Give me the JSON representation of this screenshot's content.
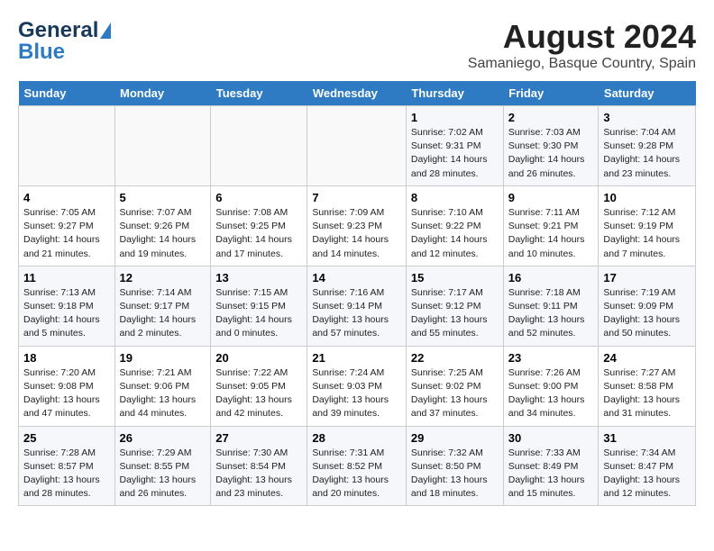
{
  "header": {
    "logo_line1": "General",
    "logo_line2": "Blue",
    "title": "August 2024",
    "subtitle": "Samaniego, Basque Country, Spain"
  },
  "days_of_week": [
    "Sunday",
    "Monday",
    "Tuesday",
    "Wednesday",
    "Thursday",
    "Friday",
    "Saturday"
  ],
  "weeks": [
    [
      {
        "day": "",
        "info": ""
      },
      {
        "day": "",
        "info": ""
      },
      {
        "day": "",
        "info": ""
      },
      {
        "day": "",
        "info": ""
      },
      {
        "day": "1",
        "info": "Sunrise: 7:02 AM\nSunset: 9:31 PM\nDaylight: 14 hours and 28 minutes."
      },
      {
        "day": "2",
        "info": "Sunrise: 7:03 AM\nSunset: 9:30 PM\nDaylight: 14 hours and 26 minutes."
      },
      {
        "day": "3",
        "info": "Sunrise: 7:04 AM\nSunset: 9:28 PM\nDaylight: 14 hours and 23 minutes."
      }
    ],
    [
      {
        "day": "4",
        "info": "Sunrise: 7:05 AM\nSunset: 9:27 PM\nDaylight: 14 hours and 21 minutes."
      },
      {
        "day": "5",
        "info": "Sunrise: 7:07 AM\nSunset: 9:26 PM\nDaylight: 14 hours and 19 minutes."
      },
      {
        "day": "6",
        "info": "Sunrise: 7:08 AM\nSunset: 9:25 PM\nDaylight: 14 hours and 17 minutes."
      },
      {
        "day": "7",
        "info": "Sunrise: 7:09 AM\nSunset: 9:23 PM\nDaylight: 14 hours and 14 minutes."
      },
      {
        "day": "8",
        "info": "Sunrise: 7:10 AM\nSunset: 9:22 PM\nDaylight: 14 hours and 12 minutes."
      },
      {
        "day": "9",
        "info": "Sunrise: 7:11 AM\nSunset: 9:21 PM\nDaylight: 14 hours and 10 minutes."
      },
      {
        "day": "10",
        "info": "Sunrise: 7:12 AM\nSunset: 9:19 PM\nDaylight: 14 hours and 7 minutes."
      }
    ],
    [
      {
        "day": "11",
        "info": "Sunrise: 7:13 AM\nSunset: 9:18 PM\nDaylight: 14 hours and 5 minutes."
      },
      {
        "day": "12",
        "info": "Sunrise: 7:14 AM\nSunset: 9:17 PM\nDaylight: 14 hours and 2 minutes."
      },
      {
        "day": "13",
        "info": "Sunrise: 7:15 AM\nSunset: 9:15 PM\nDaylight: 14 hours and 0 minutes."
      },
      {
        "day": "14",
        "info": "Sunrise: 7:16 AM\nSunset: 9:14 PM\nDaylight: 13 hours and 57 minutes."
      },
      {
        "day": "15",
        "info": "Sunrise: 7:17 AM\nSunset: 9:12 PM\nDaylight: 13 hours and 55 minutes."
      },
      {
        "day": "16",
        "info": "Sunrise: 7:18 AM\nSunset: 9:11 PM\nDaylight: 13 hours and 52 minutes."
      },
      {
        "day": "17",
        "info": "Sunrise: 7:19 AM\nSunset: 9:09 PM\nDaylight: 13 hours and 50 minutes."
      }
    ],
    [
      {
        "day": "18",
        "info": "Sunrise: 7:20 AM\nSunset: 9:08 PM\nDaylight: 13 hours and 47 minutes."
      },
      {
        "day": "19",
        "info": "Sunrise: 7:21 AM\nSunset: 9:06 PM\nDaylight: 13 hours and 44 minutes."
      },
      {
        "day": "20",
        "info": "Sunrise: 7:22 AM\nSunset: 9:05 PM\nDaylight: 13 hours and 42 minutes."
      },
      {
        "day": "21",
        "info": "Sunrise: 7:24 AM\nSunset: 9:03 PM\nDaylight: 13 hours and 39 minutes."
      },
      {
        "day": "22",
        "info": "Sunrise: 7:25 AM\nSunset: 9:02 PM\nDaylight: 13 hours and 37 minutes."
      },
      {
        "day": "23",
        "info": "Sunrise: 7:26 AM\nSunset: 9:00 PM\nDaylight: 13 hours and 34 minutes."
      },
      {
        "day": "24",
        "info": "Sunrise: 7:27 AM\nSunset: 8:58 PM\nDaylight: 13 hours and 31 minutes."
      }
    ],
    [
      {
        "day": "25",
        "info": "Sunrise: 7:28 AM\nSunset: 8:57 PM\nDaylight: 13 hours and 28 minutes."
      },
      {
        "day": "26",
        "info": "Sunrise: 7:29 AM\nSunset: 8:55 PM\nDaylight: 13 hours and 26 minutes."
      },
      {
        "day": "27",
        "info": "Sunrise: 7:30 AM\nSunset: 8:54 PM\nDaylight: 13 hours and 23 minutes."
      },
      {
        "day": "28",
        "info": "Sunrise: 7:31 AM\nSunset: 8:52 PM\nDaylight: 13 hours and 20 minutes."
      },
      {
        "day": "29",
        "info": "Sunrise: 7:32 AM\nSunset: 8:50 PM\nDaylight: 13 hours and 18 minutes."
      },
      {
        "day": "30",
        "info": "Sunrise: 7:33 AM\nSunset: 8:49 PM\nDaylight: 13 hours and 15 minutes."
      },
      {
        "day": "31",
        "info": "Sunrise: 7:34 AM\nSunset: 8:47 PM\nDaylight: 13 hours and 12 minutes."
      }
    ]
  ]
}
